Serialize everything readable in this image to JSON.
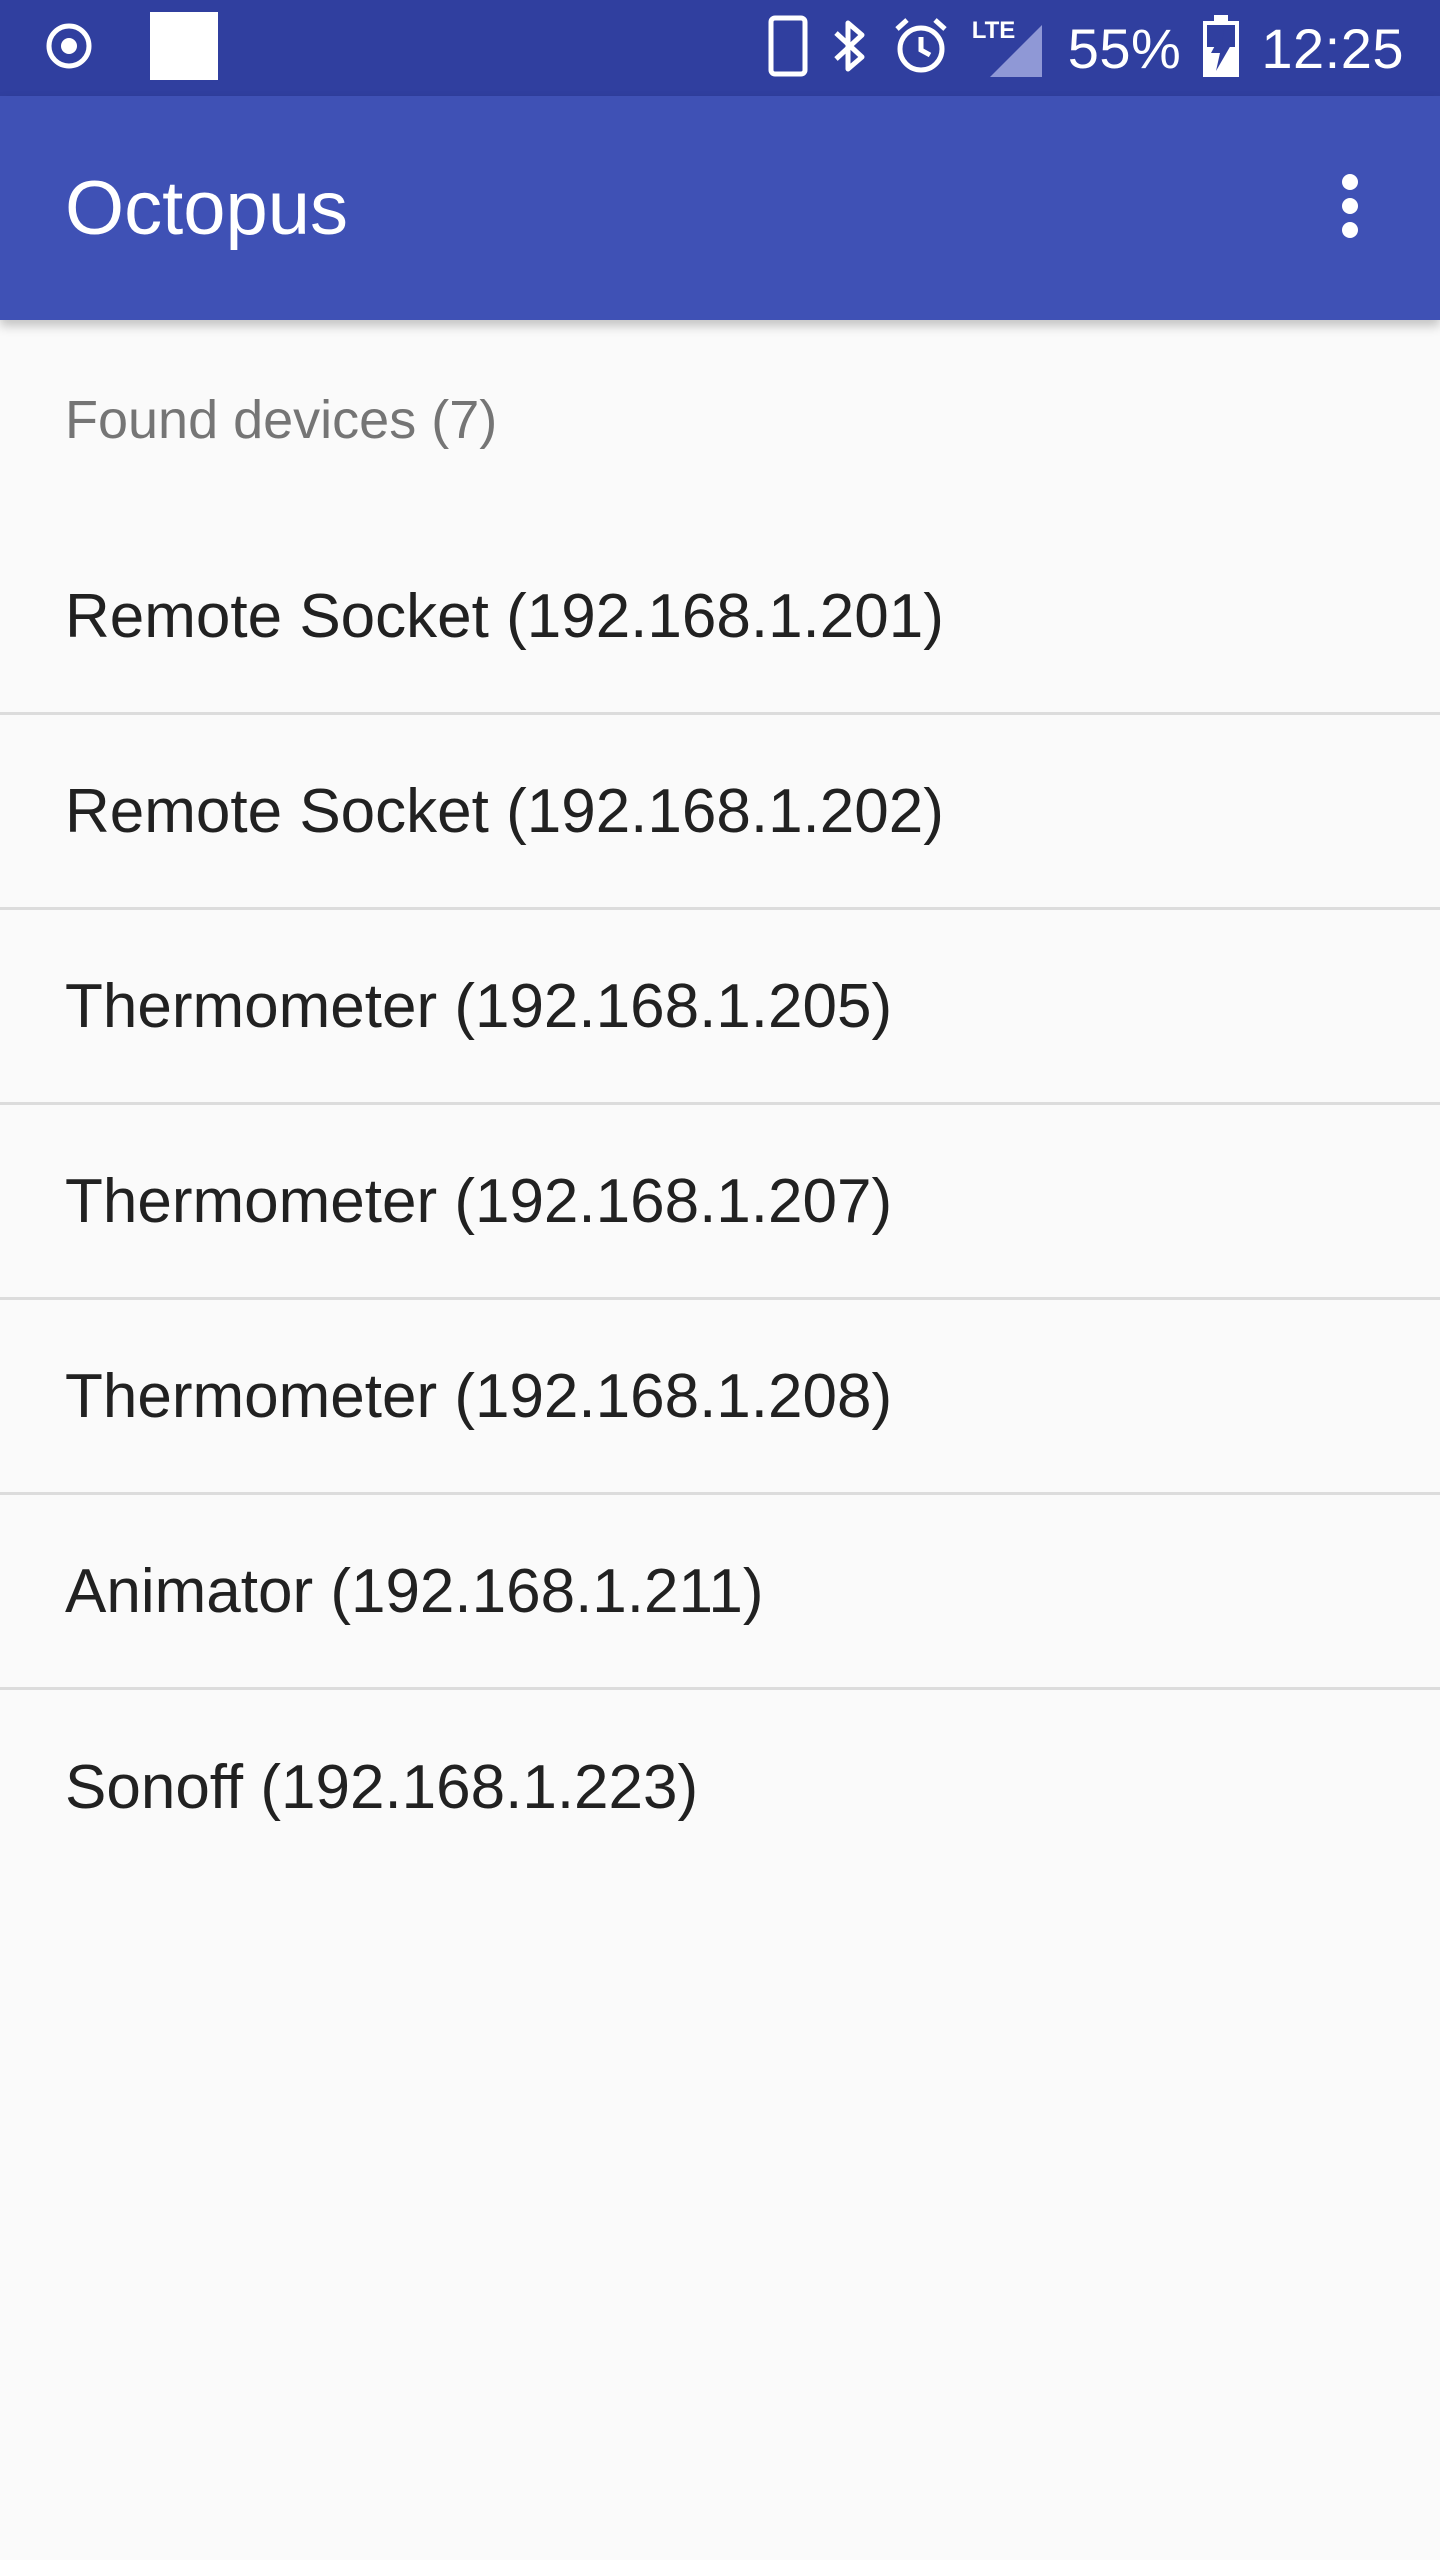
{
  "status_bar": {
    "battery_percent": "55%",
    "time": "12:25",
    "network_type": "LTE",
    "icons": [
      "record-icon",
      "notification-square-icon",
      "phone-icon",
      "bluetooth-icon",
      "alarm-icon",
      "lte-signal-icon",
      "battery-charging-icon"
    ]
  },
  "app_bar": {
    "title": "Octopus",
    "overflow_icon": "more-vert-icon"
  },
  "main": {
    "section_header": "Found devices (7)",
    "devices": [
      {
        "label": "Remote Socket (192.168.1.201)"
      },
      {
        "label": "Remote Socket (192.168.1.202)"
      },
      {
        "label": "Thermometer (192.168.1.205)"
      },
      {
        "label": "Thermometer (192.168.1.207)"
      },
      {
        "label": "Thermometer (192.168.1.208)"
      },
      {
        "label": "Animator (192.168.1.211)"
      },
      {
        "label": "Sonoff (192.168.1.223)"
      }
    ]
  },
  "colors": {
    "status_bar": "#303f9f",
    "app_bar": "#3f51b5",
    "background": "#fafafa",
    "divider": "#dcdcdc"
  }
}
